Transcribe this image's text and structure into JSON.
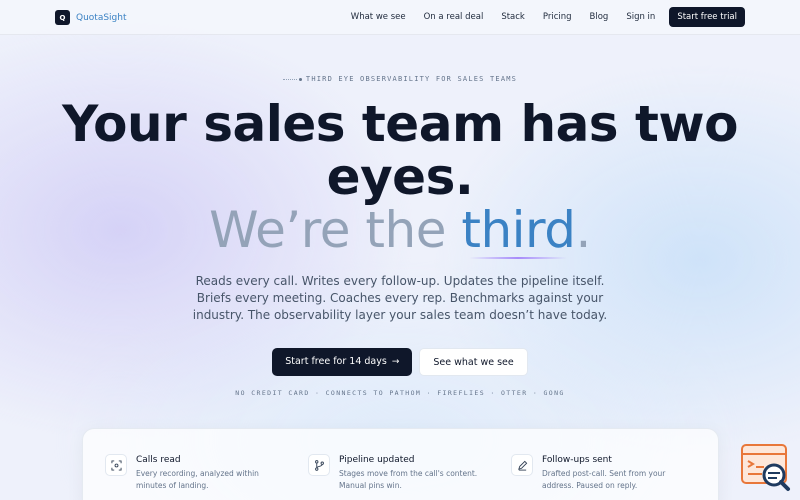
{
  "brand": {
    "mark": "Q",
    "name": "QuotaSight"
  },
  "nav": {
    "links": [
      "What we see",
      "On a real deal",
      "Stack",
      "Pricing",
      "Blog",
      "Sign in"
    ],
    "cta": "Start free trial"
  },
  "hero": {
    "eyebrow": "THIRD EYE OBSERVABILITY FOR SALES TEAMS",
    "headline": "Your sales team has two eyes.",
    "subline_a": "We’re the ",
    "subline_b": "third",
    "subline_c": ".",
    "paragraph": "Reads every call. Writes every follow-up. Updates the pipeline itself. Briefs every meeting. Coaches every rep. Benchmarks against your industry. The observability layer your sales team doesn’t have today.",
    "primary_cta": "Start free for 14 days",
    "secondary_cta": "See what we see",
    "trust_line": "NO CREDIT CARD · CONNECTS TO PATHOM · FIREFLIES · OTTER · GONG"
  },
  "features": [
    {
      "icon": "scan-icon",
      "title": "Calls read",
      "desc": "Every recording, analyzed within minutes of landing."
    },
    {
      "icon": "branch-icon",
      "title": "Pipeline updated",
      "desc": "Stages move from the call's content. Manual pins win."
    },
    {
      "icon": "pencil-icon",
      "title": "Follow-ups sent",
      "desc": "Drafted post-call. Sent from your address. Paused on reply."
    }
  ],
  "colors": {
    "accent": "#3b82c4",
    "dark": "#0f172a",
    "muted": "#94a3b8",
    "fab_orange": "#e8773a"
  }
}
